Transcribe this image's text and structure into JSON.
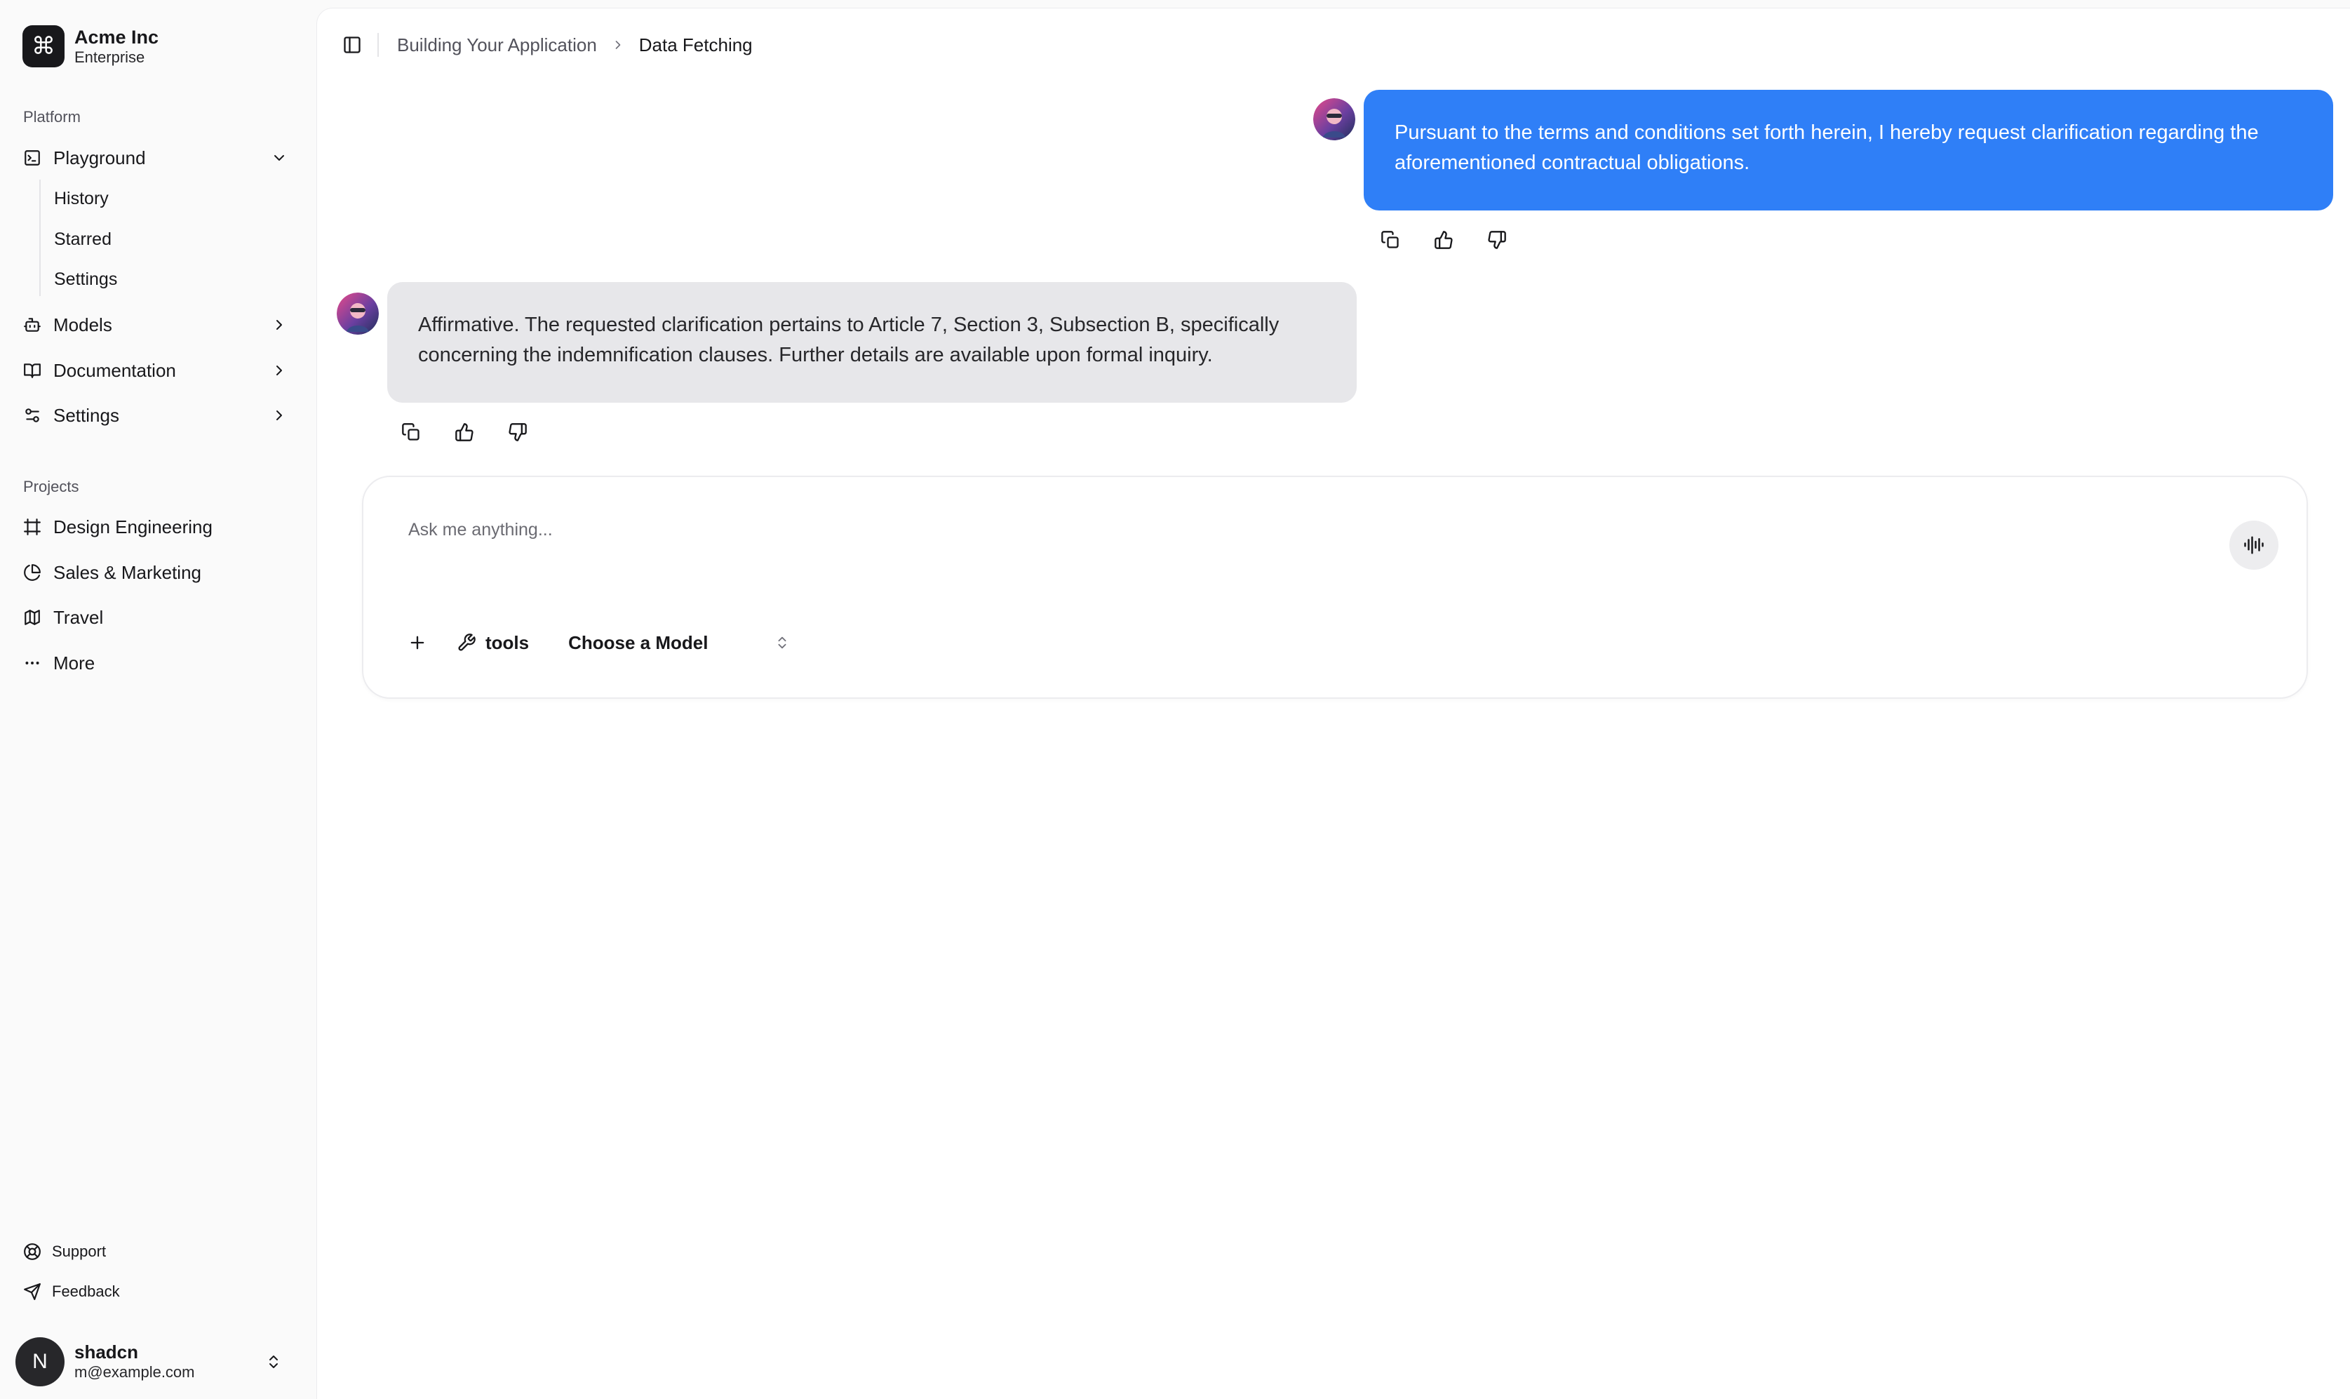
{
  "team": {
    "logo_glyph": "⌘",
    "name": "Acme Inc",
    "plan": "Enterprise"
  },
  "sidebar": {
    "platform_label": "Platform",
    "platform_items": [
      {
        "label": "Playground",
        "icon": "terminal-square-icon",
        "expanded": true
      },
      {
        "label": "Models",
        "icon": "bot-icon",
        "expanded": false
      },
      {
        "label": "Documentation",
        "icon": "book-open-icon",
        "expanded": false
      },
      {
        "label": "Settings",
        "icon": "settings-2-icon",
        "expanded": false
      }
    ],
    "playground_sub": [
      "History",
      "Starred",
      "Settings"
    ],
    "projects_label": "Projects",
    "projects": [
      {
        "label": "Design Engineering",
        "icon": "frame-icon"
      },
      {
        "label": "Sales & Marketing",
        "icon": "pie-chart-icon"
      },
      {
        "label": "Travel",
        "icon": "map-icon"
      },
      {
        "label": "More",
        "icon": "more-horizontal-icon"
      }
    ],
    "footer": [
      {
        "label": "Support",
        "icon": "life-buoy-icon"
      },
      {
        "label": "Feedback",
        "icon": "send-icon"
      }
    ],
    "user": {
      "initial": "N",
      "name": "shadcn",
      "email": "m@example.com"
    }
  },
  "breadcrumb": {
    "parent": "Building Your Application",
    "current": "Data Fetching"
  },
  "messages": [
    {
      "role": "user",
      "text": "Pursuant to the terms and conditions set forth herein, I hereby request clarification regarding the aforementioned contractual obligations."
    },
    {
      "role": "assistant",
      "text": "Affirmative. The requested clarification pertains to Article 7, Section 3, Subsection B, specifically concerning the indemnification clauses. Further details are available upon formal inquiry."
    }
  ],
  "composer": {
    "placeholder": "Ask me anything...",
    "value": "",
    "tools_label": "tools",
    "model_label": "Choose a Model"
  },
  "colors": {
    "user_bubble": "#2f7ff7",
    "assistant_bubble": "#e7e7ea",
    "sidebar_bg": "#fafafa"
  }
}
